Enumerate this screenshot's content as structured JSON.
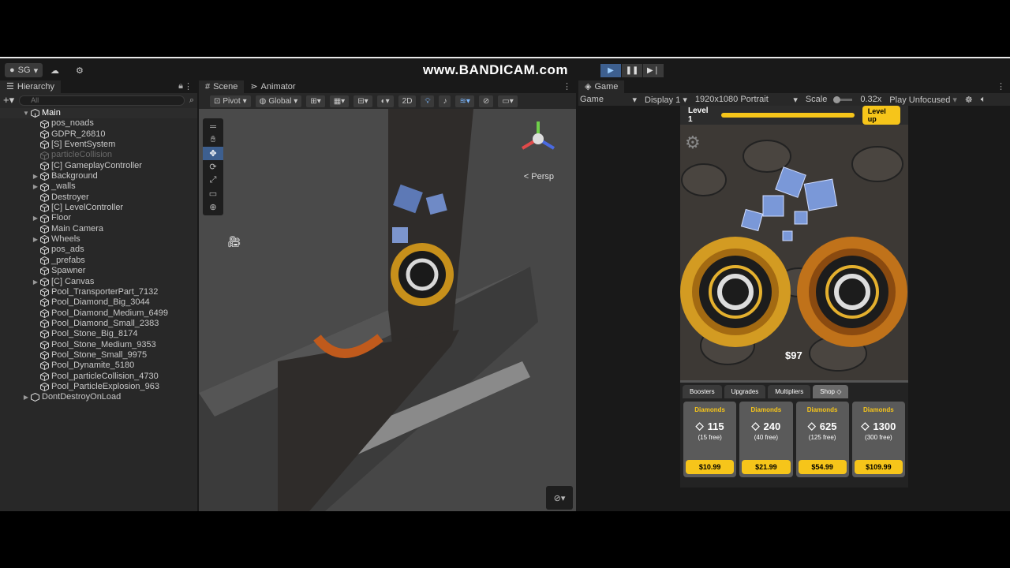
{
  "toolbar": {
    "account": "SG",
    "watermark": "www.BANDICAM.com"
  },
  "hierarchy": {
    "tab": "Hierarchy",
    "search_placeholder": "All",
    "root": "Main",
    "items": [
      {
        "label": "pos_noads",
        "expand": false,
        "dim": false
      },
      {
        "label": "GDPR_26810",
        "expand": false,
        "dim": false
      },
      {
        "label": "[S] EventSystem",
        "expand": false,
        "dim": false
      },
      {
        "label": "particleCollision",
        "expand": false,
        "dim": true
      },
      {
        "label": "[C] GameplayController",
        "expand": false,
        "dim": false
      },
      {
        "label": "Background",
        "expand": true,
        "dim": false
      },
      {
        "label": "_walls",
        "expand": true,
        "dim": false
      },
      {
        "label": "Destroyer",
        "expand": false,
        "dim": false
      },
      {
        "label": "[C] LevelController",
        "expand": false,
        "dim": false
      },
      {
        "label": "Floor",
        "expand": true,
        "dim": false
      },
      {
        "label": "Main Camera",
        "expand": false,
        "dim": false
      },
      {
        "label": "Wheels",
        "expand": true,
        "dim": false
      },
      {
        "label": "pos_ads",
        "expand": false,
        "dim": false
      },
      {
        "label": "_prefabs",
        "expand": false,
        "dim": false
      },
      {
        "label": "Spawner",
        "expand": false,
        "dim": false
      },
      {
        "label": "[C] Canvas",
        "expand": true,
        "dim": false
      },
      {
        "label": "Pool_TransporterPart_7132",
        "expand": false,
        "dim": false
      },
      {
        "label": "Pool_Diamond_Big_3044",
        "expand": false,
        "dim": false
      },
      {
        "label": "Pool_Diamond_Medium_6499",
        "expand": false,
        "dim": false
      },
      {
        "label": "Pool_Diamond_Small_2383",
        "expand": false,
        "dim": false
      },
      {
        "label": "Pool_Stone_Big_8174",
        "expand": false,
        "dim": false
      },
      {
        "label": "Pool_Stone_Medium_9353",
        "expand": false,
        "dim": false
      },
      {
        "label": "Pool_Stone_Small_9975",
        "expand": false,
        "dim": false
      },
      {
        "label": "Pool_Dynamite_5180",
        "expand": false,
        "dim": false
      },
      {
        "label": "Pool_particleCollision_4730",
        "expand": false,
        "dim": false
      },
      {
        "label": "Pool_ParticleExplosion_963",
        "expand": false,
        "dim": false
      }
    ],
    "dont_destroy": "DontDestroyOnLoad"
  },
  "scene": {
    "tab_scene": "Scene",
    "tab_animator": "Animator",
    "pivot": "Pivot",
    "global": "Global",
    "mode_2d": "2D",
    "persp": "Persp"
  },
  "game": {
    "tab": "Game",
    "view": "Game",
    "display": "Display 1",
    "resolution": "1920x1080 Portrait",
    "scale_label": "Scale",
    "scale_value": "0.32x",
    "play_mode": "Play Unfocused",
    "level": "Level 1",
    "level_progress": 1.0,
    "level_up": "Level up",
    "money": "$97",
    "shop_tabs": [
      "Boosters",
      "Upgrades",
      "Multipliers",
      "Shop"
    ],
    "cards": [
      {
        "title": "Diamonds",
        "amount": "115",
        "free": "(15 free)",
        "price": "$10.99"
      },
      {
        "title": "Diamonds",
        "amount": "240",
        "free": "(40 free)",
        "price": "$21.99"
      },
      {
        "title": "Diamonds",
        "amount": "625",
        "free": "(125 free)",
        "price": "$54.99"
      },
      {
        "title": "Diamonds",
        "amount": "1300",
        "free": "(300 free)",
        "price": "$109.99"
      }
    ]
  },
  "colors": {
    "accent": "#f6c51a",
    "selection": "#3d5f8f"
  }
}
